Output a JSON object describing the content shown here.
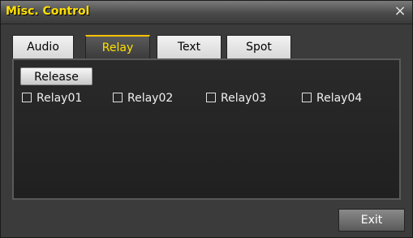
{
  "window": {
    "title": "Misc. Control",
    "close_icon": "×"
  },
  "tabs": [
    {
      "label": "Audio",
      "active": false
    },
    {
      "label": "Relay",
      "active": true
    },
    {
      "label": "Text",
      "active": false
    },
    {
      "label": "Spot",
      "active": false
    }
  ],
  "relay_panel": {
    "release_label": "Release",
    "relays": [
      {
        "label": "Relay01",
        "checked": false
      },
      {
        "label": "Relay02",
        "checked": false
      },
      {
        "label": "Relay03",
        "checked": false
      },
      {
        "label": "Relay04",
        "checked": false
      }
    ]
  },
  "footer": {
    "exit_label": "Exit"
  },
  "colors": {
    "title": "#ffe000",
    "active_tab_text": "#ffe000",
    "active_tab_border": "#ffc000"
  }
}
